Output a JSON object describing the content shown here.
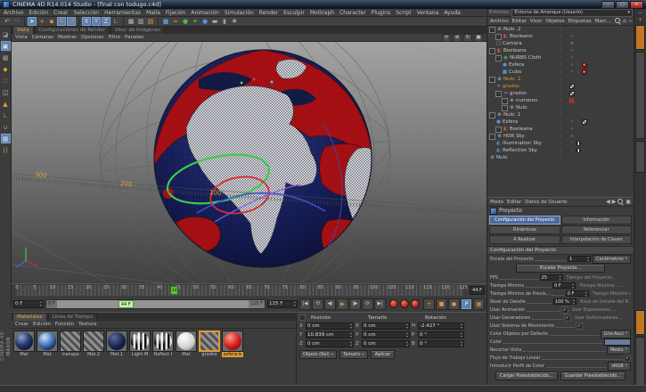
{
  "window": {
    "title": "CINEMA 4D R14.014 Studio - [final con todugo.c4d]",
    "controls": {
      "minimize": "–",
      "maximize": "▢",
      "close": "✕"
    }
  },
  "menubar": {
    "items": [
      "Archivo",
      "Edición",
      "Crear",
      "Selección",
      "Herramientas",
      "Malla",
      "Fijación",
      "Animación",
      "Simulación",
      "Render",
      "Esculpir",
      "MoGraph",
      "Character",
      "Plugins",
      "Script",
      "Ventana",
      "Ayuda"
    ]
  },
  "environment": {
    "label": "Entorno:",
    "value": "Entorno de Arranque (Usuario)",
    "arrow": "▾"
  },
  "top_toolbar": {
    "icons": [
      {
        "name": "undo",
        "glyph": "↶",
        "color": "#b5b5b5"
      },
      {
        "name": "redo",
        "glyph": "↷",
        "color": "#6e6e6e"
      },
      {
        "sep": true
      },
      {
        "name": "live-selection",
        "glyph": "➤",
        "color": "#e0e0e0",
        "active": true
      },
      {
        "name": "move",
        "glyph": "+",
        "color": "#e09a33"
      },
      {
        "name": "scale",
        "glyph": "▪",
        "color": "#e09a33"
      },
      {
        "name": "rotate",
        "glyph": "↻",
        "color": "#e09a33",
        "active": true
      },
      {
        "name": "last-tool",
        "glyph": "↺",
        "color": "#e09a33",
        "active": true
      },
      {
        "sep": true
      },
      {
        "name": "lock-x",
        "glyph": "X",
        "color": "#d8d8d8",
        "active": true
      },
      {
        "name": "lock-y",
        "glyph": "Y",
        "color": "#d8d8d8",
        "active": true
      },
      {
        "name": "lock-z",
        "glyph": "Z",
        "color": "#d8d8d8",
        "active": true
      },
      {
        "name": "coordinate-system",
        "glyph": "∟",
        "color": "#e09a33"
      },
      {
        "sep": true
      },
      {
        "name": "render-view",
        "glyph": "▦",
        "color": "#bdbdbd"
      },
      {
        "name": "render-region",
        "glyph": "▥",
        "color": "#bdbdbd"
      },
      {
        "name": "render-settings",
        "glyph": "▤",
        "color": "#e09a33"
      },
      {
        "sep": true
      },
      {
        "name": "add-primitive",
        "glyph": "■",
        "color": "#5b8fd6"
      },
      {
        "name": "add-spline",
        "glyph": "≈",
        "color": "#e09a33"
      },
      {
        "name": "add-generator",
        "glyph": "●",
        "color": "#56b34a"
      },
      {
        "name": "add-deformer",
        "glyph": "✦",
        "color": "#56b34a"
      },
      {
        "name": "add-environment",
        "glyph": "●",
        "color": "#5b8fd6"
      },
      {
        "name": "add-floor",
        "glyph": "▬",
        "color": "#9fb7d8"
      },
      {
        "name": "add-camera",
        "glyph": "▮",
        "color": "#9f9f9f"
      },
      {
        "name": "add-light",
        "glyph": "✳",
        "color": "#e6e6a8"
      }
    ]
  },
  "left_toolbar": {
    "icons": [
      {
        "name": "make-editable",
        "glyph": "◪",
        "color": "#9a9a9a"
      },
      {
        "name": "model-mode",
        "glyph": "▣",
        "color": "#e0e0e0",
        "active": true
      },
      {
        "name": "texture-mode",
        "glyph": "▩",
        "color": "#9a9a9a"
      },
      {
        "name": "workplane-mode",
        "glyph": "◆",
        "color": "#e09a33"
      },
      {
        "name": "points-mode",
        "glyph": "∷",
        "color": "#bdbdbd"
      },
      {
        "name": "edges-mode",
        "glyph": "◫",
        "color": "#bdbdbd"
      },
      {
        "name": "polygons-mode",
        "glyph": "▲",
        "color": "#e09a33"
      },
      {
        "name": "axis-mode",
        "glyph": "∟",
        "color": "#e09a33"
      },
      {
        "name": "snap-enable",
        "glyph": "∪",
        "color": "#e09a33"
      },
      {
        "name": "snap-settings",
        "glyph": "▦",
        "color": "#d8d8d8",
        "active": true
      },
      {
        "name": "quantize",
        "glyph": "()",
        "color": "#e09a33"
      }
    ]
  },
  "viewport": {
    "tabs": [
      {
        "label": "Vista",
        "active": true
      },
      {
        "label": "Configuraciones de Render",
        "active": false
      },
      {
        "label": "Visor de Imágenes",
        "active": false
      }
    ],
    "menu": [
      "Vista",
      "Cámaras",
      "Mostrar",
      "Opciones",
      "Filtro",
      "Paneles"
    ],
    "ring_labels": [
      "300",
      "200",
      "100"
    ]
  },
  "timeline": {
    "start": 0,
    "end": 125,
    "step": 5,
    "current": "44",
    "current_label": "44 F"
  },
  "transport": {
    "range_start": "0 F",
    "range_end": "125 F",
    "slider_start": "0 F",
    "slider_current": "44 F",
    "slider_end": "125 F",
    "buttons": [
      {
        "name": "go-to-start",
        "glyph": "|◀"
      },
      {
        "name": "play-loop",
        "glyph": "⟲"
      },
      {
        "name": "previous-frame",
        "glyph": "◀|"
      },
      {
        "name": "play-forward",
        "glyph": "▶",
        "play": true
      },
      {
        "name": "next-frame",
        "glyph": "|▶"
      },
      {
        "name": "repeat",
        "glyph": "⟳"
      },
      {
        "name": "go-to-end",
        "glyph": "▶|"
      }
    ],
    "records": [
      {
        "name": "record-keyframe"
      },
      {
        "name": "autokeying"
      },
      {
        "name": "record-parameter"
      }
    ],
    "keys": [
      {
        "name": "key-position",
        "glyph": "+",
        "style": "orange"
      },
      {
        "name": "key-scale",
        "glyph": "■",
        "style": "orange"
      },
      {
        "name": "key-rotation",
        "glyph": "●",
        "style": "orange"
      },
      {
        "name": "key-parameter",
        "glyph": "P",
        "style": "blue"
      },
      {
        "name": "key-pla",
        "glyph": "▦",
        "style": "orange"
      }
    ]
  },
  "materials": {
    "tabs": [
      {
        "label": "Materiales",
        "active": true
      },
      {
        "label": "Línea de Tiempo",
        "active": false
      }
    ],
    "menu": [
      "Crear",
      "Edición",
      "Función",
      "Textura"
    ],
    "items": [
      {
        "name": "Mat",
        "kind": "sphere-navy"
      },
      {
        "name": "Mat",
        "kind": "sphere-blue"
      },
      {
        "name": "transpa",
        "kind": "stripes"
      },
      {
        "name": "Mat.2",
        "kind": "stripes"
      },
      {
        "name": "Mat.1",
        "kind": "sphere-darknavy"
      },
      {
        "name": "Light M",
        "kind": "sphere-bw"
      },
      {
        "name": "Reflect I",
        "kind": "sphere-bw"
      },
      {
        "name": "Mat",
        "kind": "sphere-white"
      },
      {
        "name": "grados",
        "kind": "stripes",
        "selected": true
      },
      {
        "name": "esfera-b",
        "kind": "sphere-red",
        "label_selected": true
      }
    ]
  },
  "branding": {
    "line1": "MAXON",
    "line2": "CINEMA 4D"
  },
  "coordinates": {
    "headers": [
      "Posición",
      "Tamaño",
      "Rotación"
    ],
    "rows": [
      {
        "a": "X",
        "av": "0 cm",
        "b": "X",
        "bv": "0 cm",
        "c": "H",
        "cv": "-2.427 °"
      },
      {
        "a": "Y",
        "av": "10.839 cm",
        "b": "Y",
        "bv": "0 cm",
        "c": "P",
        "cv": "0 °"
      },
      {
        "a": "Z",
        "av": "0 cm",
        "b": "Z",
        "bv": "0 cm",
        "c": "B",
        "cv": "0 °"
      }
    ],
    "mode1": "Objeto (Rel)",
    "mode2": "Tamaño",
    "apply": "Aplicar"
  },
  "object_manager": {
    "menu": [
      "Archivo",
      "Editar",
      "Visor",
      "Objetos",
      "Etiquetas",
      "Marc..."
    ],
    "objects": [
      {
        "name": "Nulo .2",
        "depth": 0,
        "icon": "null",
        "expand": true,
        "tags": []
      },
      {
        "name": "Booleano",
        "depth": 1,
        "icon": "boolean",
        "expand": true,
        "tags": [
          "check"
        ]
      },
      {
        "name": "Camara",
        "depth": 1,
        "icon": "camera",
        "tags": [
          "cross"
        ]
      },
      {
        "name": "Booleano",
        "depth": 0,
        "icon": "boolean",
        "expand": true,
        "tags": [
          "check"
        ]
      },
      {
        "name": "NURBS Cloth",
        "depth": 1,
        "icon": "nurbs",
        "expand": true,
        "tags": [
          "check"
        ]
      },
      {
        "name": "Esfera",
        "depth": 2,
        "icon": "sphere",
        "tags": [
          "check",
          "orange",
          "redmat"
        ]
      },
      {
        "name": "Cubo",
        "depth": 2,
        "icon": "cube",
        "tags": [
          "check",
          "orange",
          "redmat"
        ]
      },
      {
        "name": "Nulo .1",
        "depth": 0,
        "icon": "null",
        "expand": true,
        "sel": true,
        "tags": []
      },
      {
        "name": "grados",
        "depth": 1,
        "icon": "spline",
        "sel": true,
        "tags": [
          "checker"
        ]
      },
      {
        "name": "grados",
        "depth": 1,
        "icon": "spline",
        "expand": true,
        "tags": [
          "checker"
        ]
      },
      {
        "name": "numeros",
        "depth": 2,
        "icon": "null",
        "expand": true,
        "tags": [
          "redbars"
        ]
      },
      {
        "name": "Nulo",
        "depth": 2,
        "icon": "null",
        "expand": true,
        "tags": []
      },
      {
        "name": "Nulo .1",
        "depth": 0,
        "icon": "null",
        "expand": true,
        "tags": []
      },
      {
        "name": "Esfera",
        "depth": 1,
        "icon": "sphere",
        "tags": [
          "check",
          "orange",
          "checker"
        ]
      },
      {
        "name": "Booleana",
        "depth": 1,
        "icon": "boolean",
        "expand": true,
        "tags": [
          "check"
        ]
      },
      {
        "name": "HDR Sky",
        "depth": 0,
        "icon": "null",
        "expand": true,
        "tags": [
          "bluewave"
        ]
      },
      {
        "name": "Illumination Sky",
        "depth": 1,
        "icon": "sky",
        "tags": [
          "orange",
          "bwmat"
        ]
      },
      {
        "name": "Reflection Sky",
        "depth": 1,
        "icon": "sky",
        "tags": [
          "orange",
          "bwmat"
        ]
      },
      {
        "name": "Nulo",
        "depth": 0,
        "icon": "null",
        "tags": []
      }
    ]
  },
  "attributes": {
    "menu": [
      "Modo",
      "Editar",
      "Datos de Usuario"
    ],
    "object": "Proyecto",
    "tabs": [
      {
        "label": "Configuración del Proyecto",
        "active": true
      },
      {
        "label": "Información",
        "active": false
      },
      {
        "label": "Dinámicas",
        "active": false
      },
      {
        "label": "Referenciar",
        "active": false
      },
      {
        "label": "A Realizar",
        "active": false
      },
      {
        "label": "Interpolación de Claves",
        "active": false
      }
    ],
    "section": "Configuración del Proyecto",
    "scale_label": "Escala del Proyecto",
    "scale_value": "1",
    "scale_unit": "Centímetros",
    "scale_button": "Escalar Proyecto...",
    "rows": [
      {
        "l": "FPS",
        "v": "25",
        "r": "Tiempo del Proyecto.."
      },
      {
        "l": "Tiempo Mínimo",
        "v": "0 F",
        "r": "Tiempo Máximo ....."
      },
      {
        "l": "Tiempo Mínimo de Previs...",
        "v": "0 F",
        "r": "Tiempo Máximo de Pr..."
      },
      {
        "l": "Nivel de Detalle",
        "v": "100 %",
        "r": "Nivel de Detalle del R..."
      },
      {
        "l": "Usar Animación",
        "check": true,
        "r": "Usar Expresiones....."
      },
      {
        "l": "Usar Generadores",
        "check": true,
        "r": "Usar Deformadores..."
      },
      {
        "l": "Usar Sistema de Movimiento",
        "check": true,
        "r": ""
      }
    ],
    "color_default_label": "Color Objetos por Defecto",
    "color_default_value": "Gris-Azul",
    "color_label": "Color",
    "color_swatch": "#6b7b9b",
    "clip_label": "Recortar Vista",
    "clip_value": "Medio",
    "linear_label": "Flujo de Trabajo Lineal",
    "profile_label": "Introducir Perfil de Color",
    "profile_value": "sRGB",
    "load_button": "Cargar Preestablecido...",
    "save_button": "Guardar Preestablecido...",
    "check_glyph": "✓"
  }
}
